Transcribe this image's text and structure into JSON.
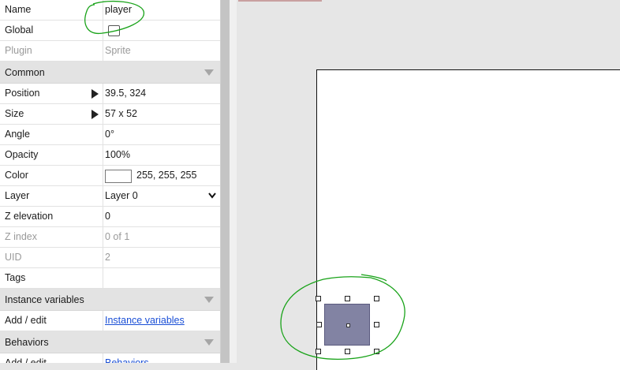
{
  "properties": {
    "name": {
      "label": "Name",
      "value": "player"
    },
    "global": {
      "label": "Global",
      "checked": false
    },
    "plugin": {
      "label": "Plugin",
      "value": "Sprite"
    },
    "section_common": "Common",
    "position": {
      "label": "Position",
      "value": "39.5, 324"
    },
    "size": {
      "label": "Size",
      "value": "57 x 52"
    },
    "angle": {
      "label": "Angle",
      "value": "0°"
    },
    "opacity": {
      "label": "Opacity",
      "value": "100%"
    },
    "color": {
      "label": "Color",
      "value": "255, 255, 255",
      "swatch": "#ffffff"
    },
    "layer": {
      "label": "Layer",
      "value": "Layer 0"
    },
    "z_elevation": {
      "label": "Z elevation",
      "value": "0"
    },
    "z_index": {
      "label": "Z index",
      "value": "0 of 1"
    },
    "uid": {
      "label": "UID",
      "value": "2"
    },
    "tags": {
      "label": "Tags",
      "value": ""
    },
    "section_instance_variables": "Instance variables",
    "add_edit_vars": {
      "label": "Add / edit",
      "value": "Instance variables"
    },
    "section_behaviors": "Behaviors",
    "add_edit_behaviors": {
      "label": "Add / edit",
      "value": "Behaviors"
    }
  },
  "colors": {
    "sprite_fill": "#8283a3",
    "annotation": "#1aa31a",
    "link": "#1a4fd6"
  },
  "icons": [
    "expand-arrow-icon",
    "collapse-arrow-icon",
    "chevron-down-icon"
  ]
}
